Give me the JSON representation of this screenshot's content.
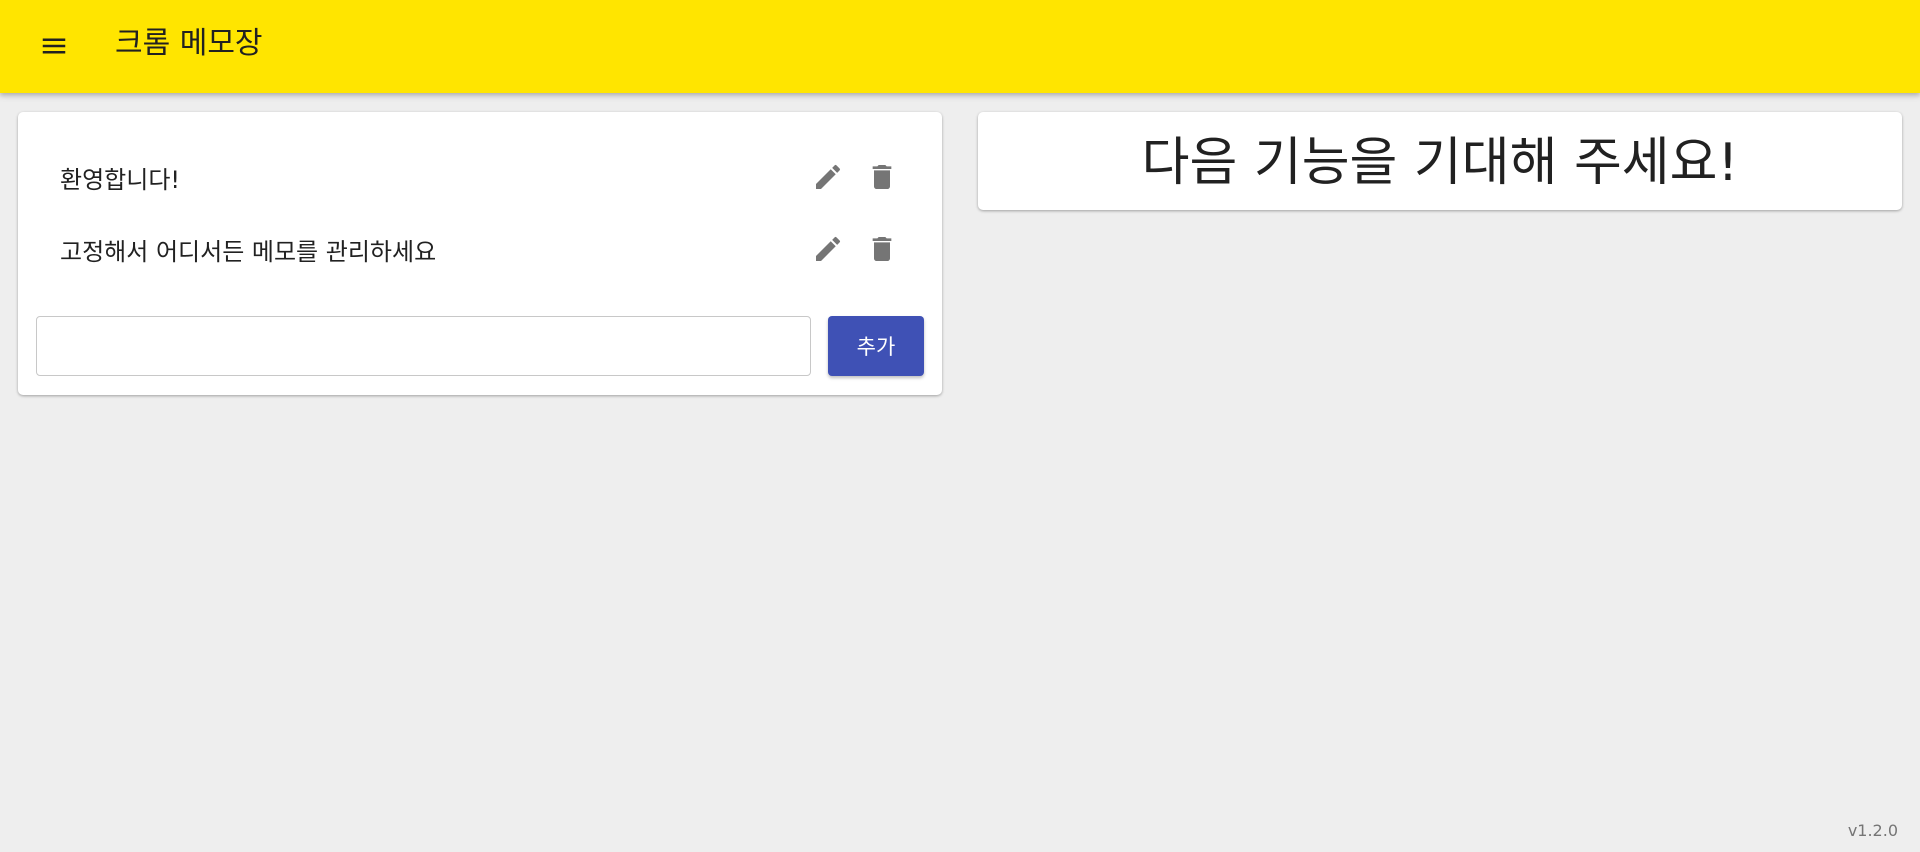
{
  "header": {
    "menu_icon": "menu-icon",
    "title": "크롬 메모장",
    "background_color": "#ffe500"
  },
  "memos": {
    "items": [
      {
        "text": "환영합니다!",
        "edit_icon": "pencil-icon",
        "delete_icon": "trash-icon"
      },
      {
        "text": "고정해서 어디서든 메모를 관리하세요",
        "edit_icon": "pencil-icon",
        "delete_icon": "trash-icon"
      }
    ],
    "input": {
      "value": "",
      "placeholder": ""
    },
    "add_label": "추가",
    "add_button_color": "#3f51b5"
  },
  "coming_soon": {
    "message": "다음 기능을 기대해 주세요!"
  },
  "footer": {
    "version": "v1.2.0"
  }
}
